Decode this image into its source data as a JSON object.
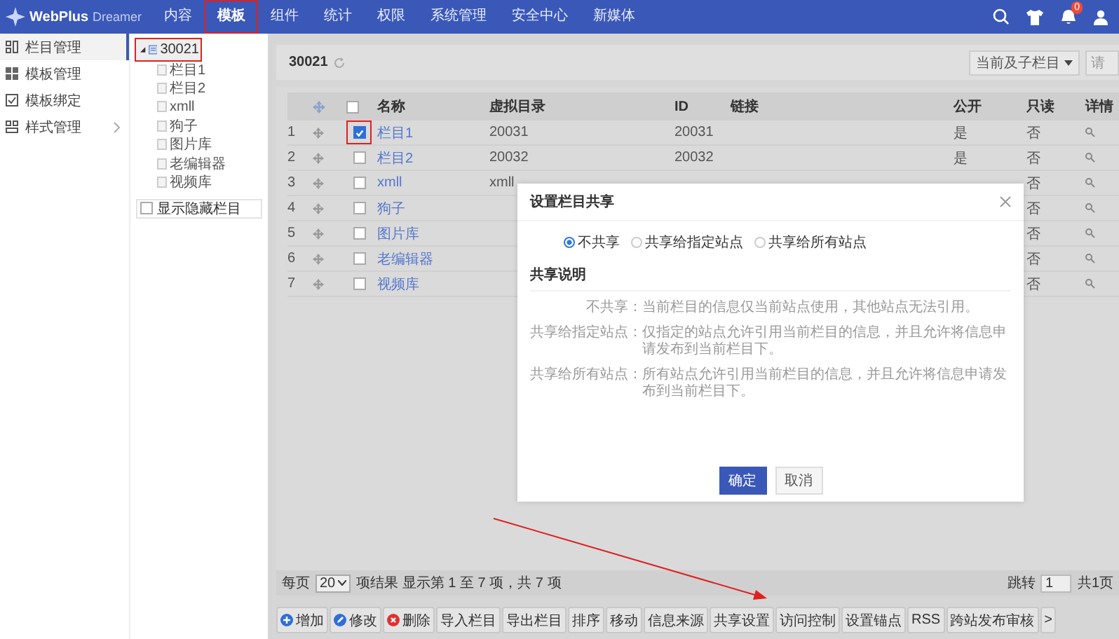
{
  "header": {
    "logo": "WebPlus",
    "logo_sub": "Dreamer",
    "notification_count": "0",
    "nav": [
      {
        "label": "内容",
        "selected": false,
        "highlighted": false
      },
      {
        "label": "模板",
        "selected": true,
        "highlighted": true
      },
      {
        "label": "组件",
        "selected": false,
        "highlighted": false
      },
      {
        "label": "统计",
        "selected": false,
        "highlighted": false
      },
      {
        "label": "权限",
        "selected": false,
        "highlighted": false
      },
      {
        "label": "系统管理",
        "selected": false,
        "highlighted": false
      },
      {
        "label": "安全中心",
        "selected": false,
        "highlighted": false
      },
      {
        "label": "新媒体",
        "selected": false,
        "highlighted": false
      }
    ]
  },
  "sidebar": {
    "items": [
      {
        "label": "栏目管理",
        "selected": true,
        "kind": "columns",
        "has_submenu": false
      },
      {
        "label": "模板管理",
        "selected": false,
        "kind": "templates",
        "has_submenu": false
      },
      {
        "label": "模板绑定",
        "selected": false,
        "kind": "binding",
        "has_submenu": false
      },
      {
        "label": "样式管理",
        "selected": false,
        "kind": "styles",
        "has_submenu": true
      }
    ]
  },
  "tree": {
    "root": {
      "label": "30021",
      "selected": true,
      "highlighted": true,
      "expanded": true,
      "children": [
        {
          "label": "栏目1"
        },
        {
          "label": "栏目2"
        },
        {
          "label": "xmll"
        },
        {
          "label": "狗子"
        },
        {
          "label": "图片库"
        },
        {
          "label": "老编辑器"
        },
        {
          "label": "视频库"
        }
      ]
    },
    "show_hidden": {
      "label": "显示隐藏栏目",
      "checked": false
    }
  },
  "main": {
    "breadcrumb": "30021",
    "scope_select": "当前及子栏目",
    "search_placeholder": "请"
  },
  "table": {
    "select_all_checked": false,
    "columns": [
      "名称",
      "虚拟目录",
      "ID",
      "链接",
      "公开",
      "只读",
      "详情"
    ],
    "rows": [
      {
        "index": "1",
        "checked": true,
        "highlighted": true,
        "name": "栏目1",
        "vdir": "20031",
        "id": "20031",
        "public": "是",
        "readonly": "否"
      },
      {
        "index": "2",
        "checked": false,
        "highlighted": false,
        "name": "栏目2",
        "vdir": "20032",
        "id": "20032",
        "public": "是",
        "readonly": "否"
      },
      {
        "index": "3",
        "checked": false,
        "highlighted": false,
        "name": "xmll",
        "vdir": "xmll",
        "readonly": "否"
      },
      {
        "index": "4",
        "checked": false,
        "highlighted": false,
        "name": "狗子",
        "readonly": "否"
      },
      {
        "index": "5",
        "checked": false,
        "highlighted": false,
        "name": "图片库",
        "readonly": "否"
      },
      {
        "index": "6",
        "checked": false,
        "highlighted": false,
        "name": "老编辑器",
        "readonly": "否"
      },
      {
        "index": "7",
        "checked": false,
        "highlighted": false,
        "name": "视频库",
        "readonly": "否"
      }
    ]
  },
  "pager": {
    "per_page_label": "每页",
    "per_page": "20",
    "summary": "项结果 显示第 1 至 7 项，共 7 项",
    "jump_label": "跳转",
    "jump_value": "1",
    "total_pages": "共1页"
  },
  "toolbar": [
    {
      "label": "增加",
      "kind": "add"
    },
    {
      "label": "修改",
      "kind": "edit"
    },
    {
      "label": "删除",
      "kind": "delete"
    },
    {
      "label": "导入栏目",
      "kind": "plain"
    },
    {
      "label": "导出栏目",
      "kind": "plain"
    },
    {
      "label": "排序",
      "kind": "plain"
    },
    {
      "label": "移动",
      "kind": "plain"
    },
    {
      "label": "信息来源",
      "kind": "plain"
    },
    {
      "label": "共享设置",
      "kind": "plain"
    },
    {
      "label": "访问控制",
      "kind": "plain"
    },
    {
      "label": "设置锚点",
      "kind": "plain"
    },
    {
      "label": "RSS",
      "kind": "plain"
    },
    {
      "label": "跨站发布审核",
      "kind": "plain"
    },
    {
      "label": ">",
      "kind": "plain"
    }
  ],
  "dialog": {
    "title": "设置栏目共享",
    "options": [
      {
        "label": "不共享",
        "selected": true
      },
      {
        "label": "共享给指定站点",
        "selected": false
      },
      {
        "label": "共享给所有站点",
        "selected": false
      }
    ],
    "section": "共享说明",
    "notes": [
      {
        "label": "不共享：",
        "text": "当前栏目的信息仅当前站点使用，其他站点无法引用。"
      },
      {
        "label": "共享给指定站点：",
        "text": "仅指定的站点允许引用当前栏目的信息，并且允许将信息申请发布到当前栏目下。"
      },
      {
        "label": "共享给所有站点：",
        "text": "所有站点允许引用当前栏目的信息，并且允许将信息申请发布到当前栏目下。"
      }
    ],
    "buttons": [
      {
        "label": "确定",
        "kind": "primary"
      },
      {
        "label": "取消",
        "kind": "default"
      }
    ]
  }
}
